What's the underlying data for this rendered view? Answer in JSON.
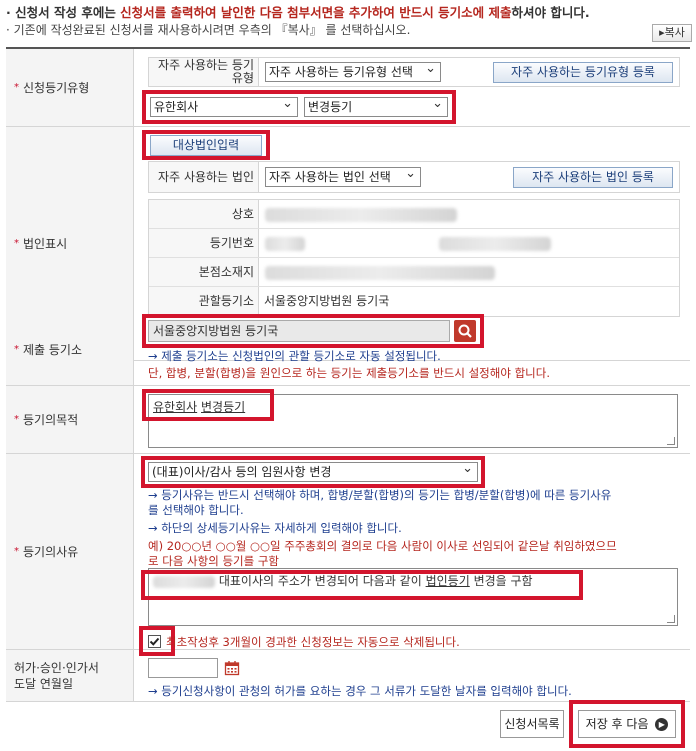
{
  "notice": {
    "line1_pre": "신청서 작성 후에는 ",
    "line1_red": "신청서를 출력하여 날인한 다음 첨부서면을 추가하여 반드시 등기소에 제출",
    "line1_post": "하셔야 합니다.",
    "line2": "기존에 작성완료된 신청서를 재사용하시려면 우측의 『복사』 를 선택하십시오.",
    "copy_label": "복사"
  },
  "registration_type": {
    "label": "신청등기유형",
    "fav_label": "자주 사용하는 등기유형",
    "fav_select": "자주 사용하는 등기유형 선택",
    "fav_button": "자주 사용하는 등기유형 등록",
    "company_type": "유한회사",
    "change_type": "변경등기"
  },
  "corporation": {
    "label": "법인표시",
    "input_button": "대상법인입력",
    "fav_label": "자주 사용하는 법인",
    "fav_select": "자주 사용하는 법인 선택",
    "fav_button": "자주 사용하는 법인 등록",
    "fields": [
      {
        "label": "상호",
        "value": ""
      },
      {
        "label": "등기번호",
        "value": ""
      },
      {
        "label": "본점소재지",
        "value": ""
      },
      {
        "label": "관할등기소",
        "value": "서울중앙지방법원 등기국"
      }
    ]
  },
  "submit_office": {
    "label": "제출 등기소",
    "value": "서울중앙지방법원  등기국",
    "hint": "→ 제출 등기소는 신청법인의 관할 등기소로 자동 설정됩니다.",
    "warn": "단, 합병, 분할(합병)을 원인으로 하는 등기는 제출등기소를 반드시 설정해야 합니다."
  },
  "purpose": {
    "label": "등기의목적",
    "text_a": "유한회사",
    "text_b": "변경등기"
  },
  "reason": {
    "label": "등기의사유",
    "select": "(대표)이사/감사 등의 임원사항 변경",
    "hint1a": "→ 등기사유는 반드시 선택해야 하며, 합병/분할(합병)의 등기는 합병/분할(합병)에 따른 등기사유",
    "hint1b": "를 선택해야 합니다.",
    "hint2": "→ 하단의 상세등기사유는 자세하게 입력해야 합니다.",
    "example1": "예) 20○○년 ○○월 ○○일 주주총회의 결의로 다음 사람이 이사로 선임되어 같은날 취임하였으므",
    "example2": "로 다음 사항의 등기를 구함",
    "detail_a": "대표이사의 주소가 변경되어 다음과 같이 ",
    "detail_b": "법인등기",
    "detail_c": " 변경을 구함",
    "auto_delete": "최초작성후 3개월이 경과한 신청정보는 자동으로 삭제됩니다."
  },
  "permit": {
    "label_line1": "허가·승인·인가서",
    "label_line2": "도달 연월일",
    "hint": "→ 등기신청사항이 관청의 허가를 요하는 경우 그 서류가 도달한 날자를 입력해야 합니다."
  },
  "actions": {
    "list_button": "신청서목록",
    "save_next_button": "저장 후 다음"
  },
  "colors": {
    "highlight_red": "#d3152d",
    "hint_blue": "#1f3f8f",
    "warn_red": "#b5261e"
  }
}
